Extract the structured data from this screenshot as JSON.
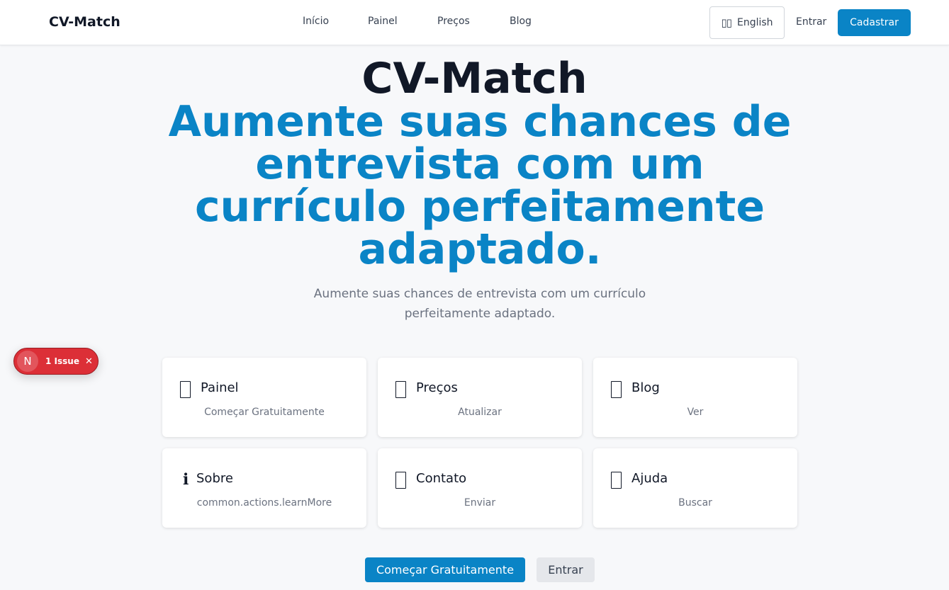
{
  "header": {
    "brand": "CV-Match",
    "nav": [
      "Início",
      "Painel",
      "Preços",
      "Blog"
    ],
    "language": "English",
    "language_icon": "book-icon",
    "login": "Entrar",
    "signup": "Cadastrar"
  },
  "hero": {
    "title": "CV-Match",
    "tagline": "Aumente suas chances de entrevista com um currículo perfeitamente adaptado.",
    "subtitle": "Aumente suas chances de entrevista com um currículo perfeitamente adaptado."
  },
  "issue_badge": {
    "letter": "N",
    "text": "1 Issue",
    "close": "✕"
  },
  "cards": [
    {
      "title": "Painel",
      "action": "Começar Gratuitamente",
      "icon": "box-glyph-icon"
    },
    {
      "title": "Preços",
      "action": "Atualizar",
      "icon": "box-glyph-icon"
    },
    {
      "title": "Blog",
      "action": "Ver",
      "icon": "box-glyph-icon"
    },
    {
      "title": "Sobre",
      "action": "common.actions.learnMore",
      "icon": "info-icon",
      "icon_glyph": "ℹ"
    },
    {
      "title": "Contato",
      "action": "Enviar",
      "icon": "box-glyph-icon"
    },
    {
      "title": "Ajuda",
      "action": "Buscar",
      "icon": "box-glyph-icon"
    }
  ],
  "cta": {
    "primary": "Começar Gratuitamente",
    "secondary": "Entrar"
  },
  "colors": {
    "accent": "#0a84c6",
    "issue": "#dc2f37"
  }
}
